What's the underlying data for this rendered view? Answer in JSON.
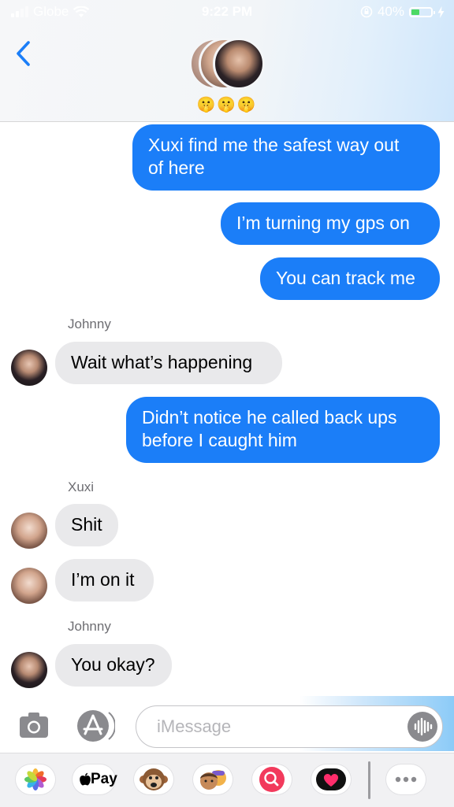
{
  "status_bar": {
    "carrier": "Globe",
    "time": "9:22 PM",
    "battery_percent": "40%",
    "battery_level": 0.4,
    "accent": "#4cd964"
  },
  "header": {
    "back_icon": "chevron-left-icon",
    "group_emojis": "🤫🤫🤫"
  },
  "messages": [
    {
      "type": "sent",
      "lines": [
        "Xuxi find me the safest way out",
        "of here"
      ]
    },
    {
      "type": "sent",
      "lines": [
        "I’m turning my gps on"
      ]
    },
    {
      "type": "sent",
      "lines": [
        "You can track me"
      ]
    },
    {
      "type": "received",
      "sender": "Johnny",
      "lines": [
        "Wait what’s happening"
      ]
    },
    {
      "type": "sent",
      "lines": [
        "Didn’t notice he called back ups",
        "before I caught him"
      ]
    },
    {
      "type": "received",
      "sender": "Xuxi",
      "lines": [
        "Shit"
      ]
    },
    {
      "type": "received",
      "lines": [
        "I’m on it"
      ]
    },
    {
      "type": "received",
      "sender": "Johnny",
      "lines": [
        "You okay?"
      ]
    }
  ],
  "input": {
    "placeholder": "iMessage",
    "camera_icon": "camera-icon",
    "appstore_icon": "app-store-icon",
    "audio_icon": "audio-waveform-icon"
  },
  "app_drawer": {
    "apple_pay_label": "Pay",
    "apps": [
      "photos-icon",
      "apple-pay-icon",
      "monkey-animoji-icon",
      "memoji-icon",
      "search-images-icon",
      "digital-touch-icon",
      "more-icon"
    ]
  },
  "colors": {
    "sent_bubble": "#1b7ef8",
    "received_bubble": "#e9e9eb",
    "ios_blue": "#1b7ef8"
  }
}
